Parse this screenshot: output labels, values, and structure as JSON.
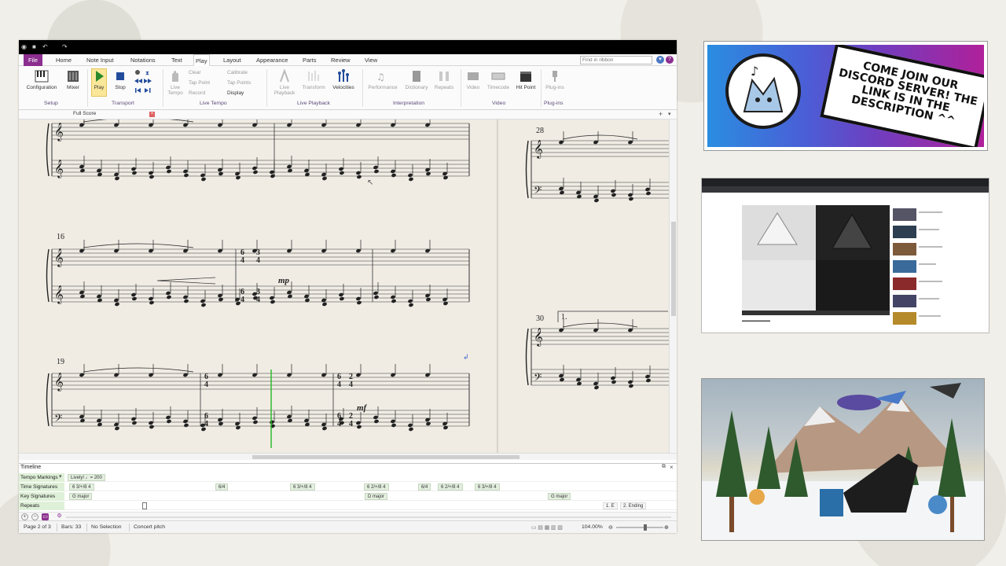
{
  "app": {
    "tabs": [
      "File",
      "Home",
      "Note Input",
      "Notations",
      "Text",
      "Play",
      "Layout",
      "Appearance",
      "Parts",
      "Review",
      "View"
    ],
    "active_tab": "Play",
    "find_placeholder": "Find in ribbon",
    "ribbon": {
      "setup": {
        "group_label": "Setup",
        "configuration": "Configuration",
        "mixer": "Mixer"
      },
      "transport": {
        "group_label": "Transport",
        "play": "Play",
        "stop": "Stop"
      },
      "live_tempo": {
        "group_label": "Live Tempo",
        "live_tempo": "Live Tempo",
        "clear": "Clear",
        "tap_point": "Tap Point",
        "record": "Record",
        "calibrate": "Calibrate",
        "tap_points": "Tap Points",
        "display": "Display"
      },
      "live_playback": {
        "group_label": "Live Playback",
        "live_playback": "Live Playback",
        "transform": "Transform",
        "velocities": "Velocities"
      },
      "interpretation": {
        "group_label": "Interpretation",
        "performance": "Performance",
        "dictionary": "Dictionary",
        "repeats": "Repeats"
      },
      "video": {
        "group_label": "Video",
        "video": "Video",
        "timecode": "Timecode",
        "hit_point": "Hit Point"
      },
      "plugins": {
        "group_label": "Plug-ins",
        "plugins": "Plug-ins"
      }
    },
    "document_tab": "Full Score",
    "score": {
      "bar_numbers": [
        "16",
        "19",
        "28",
        "30"
      ],
      "dynamics": [
        "mp",
        "mf"
      ],
      "time_signatures": [
        "6/4",
        "3/4",
        "6/4",
        "2/4"
      ],
      "ending_label": "1."
    },
    "timeline": {
      "title": "Timeline",
      "rows": [
        {
          "label": "Tempo Markings",
          "items": [
            "Lively! ♩= 200"
          ]
        },
        {
          "label": "Time Signatures",
          "items": [
            "6 3/+/8 4",
            "6/4",
            "6 3/+/8 4",
            "6 2/+/8 4",
            "6/4",
            "6 2/+/8 4",
            "6 3/+/8 4"
          ]
        },
        {
          "label": "Key Signatures",
          "items": [
            "G major",
            "D major",
            "G major"
          ]
        },
        {
          "label": "Repeats",
          "items": [
            "1. E",
            "2. Ending"
          ]
        }
      ]
    },
    "status": {
      "page": "Page 2 of 3",
      "bars": "Bars: 33",
      "selection": "No Selection",
      "pitch": "Concert pitch",
      "zoom": "104.00%"
    },
    "colors": {
      "file_tab": "#8b2e8f",
      "timeline_label": "#dff0d8",
      "playhead": "#22b922"
    }
  },
  "discord_banner": {
    "text": "COME JOIN OUR DISCORD SERVER! THE LINK IS IN THE DESCRIPTION ^^"
  }
}
